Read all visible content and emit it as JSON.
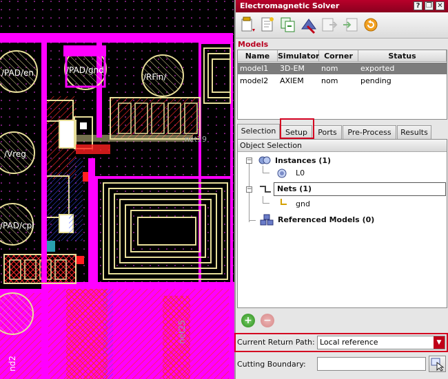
{
  "layout": {
    "pads": [
      "/PAD/en",
      "/PAD/gnd",
      "/RFin/",
      "/Vreg",
      "/PAD/cpl"
    ],
    "net_labels": [
      "net19",
      "net25",
      "nd2"
    ]
  },
  "window": {
    "title": "Electromagnetic Solver",
    "controls": [
      "?",
      "❐",
      "✕"
    ]
  },
  "toolbar": {
    "tools": [
      "new-model-icon",
      "new-document-icon",
      "copy-icon",
      "simulate-icon",
      "export-icon",
      "import-icon",
      "refresh-icon"
    ]
  },
  "models": {
    "label": "Models",
    "columns": [
      "Name",
      "Simulator",
      "Corner",
      "Status"
    ],
    "rows": [
      {
        "name": "model1",
        "simulator": "3D-EM",
        "corner": "nom",
        "status": "exported",
        "selected": true
      },
      {
        "name": "model2",
        "simulator": "AXIEM",
        "corner": "nom",
        "status": "pending",
        "selected": false
      }
    ]
  },
  "tabs": [
    "Selection",
    "Setup",
    "Ports",
    "Pre-Process",
    "Results"
  ],
  "active_tab": "Selection",
  "highlighted_tab": "Setup",
  "object_selection": {
    "header": "Object Selection",
    "instances_label": "Instances (1)",
    "instance_child": "L0",
    "nets_label": "Nets (1)",
    "net_child": "gnd",
    "ref_models_label": "Referenced Models (0)"
  },
  "buttons": {
    "add": "+",
    "remove": "−"
  },
  "fields": {
    "return_path_label": "Current Return Path:",
    "return_path_value": "Local reference",
    "cutting_boundary_label": "Cutting Boundary:",
    "cutting_boundary_value": ""
  },
  "colors": {
    "accent": "#b8001f",
    "highlight": "#d40020",
    "layout_magenta": "#ff00ff",
    "layout_red": "#ff2020",
    "layout_yellow": "#f2eaa0"
  }
}
